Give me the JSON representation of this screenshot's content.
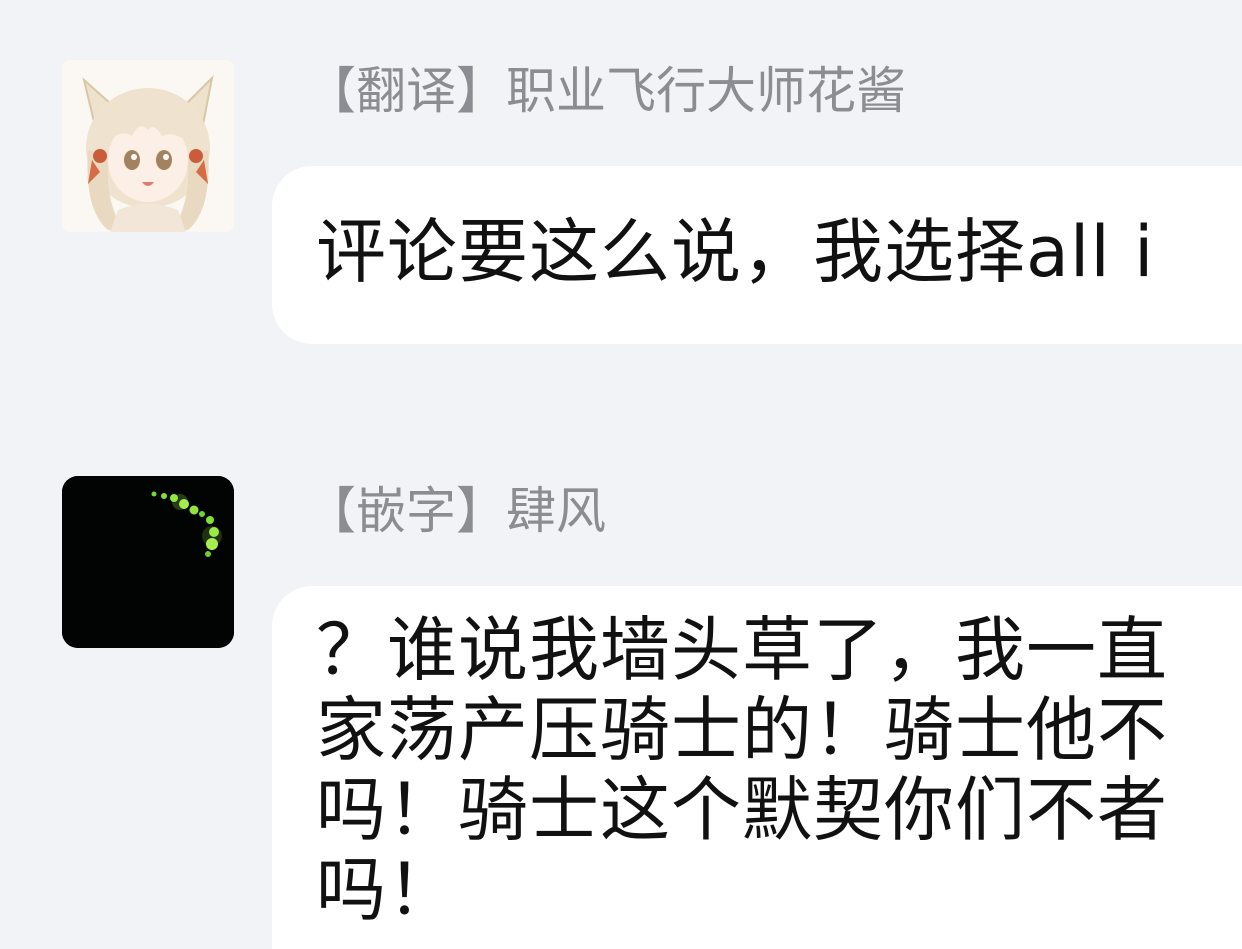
{
  "messages": [
    {
      "sender": "【翻译】职业飞行大师花酱",
      "avatar_icon": "anime-fox-girl-avatar-icon",
      "text": "评论要这么说，我选择all i"
    },
    {
      "sender": "【嵌字】肆风",
      "avatar_icon": "firefly-dark-avatar-icon",
      "text": "？谁说我墙头草了，我一直\n家荡产压骑士的！骑士他不\n吗！骑士这个默契你们不者\n吗！"
    }
  ],
  "colors": {
    "background": "#f2f3f7",
    "bubble": "#ffffff",
    "sender_text": "#8b8d93",
    "message_text": "#111111"
  }
}
